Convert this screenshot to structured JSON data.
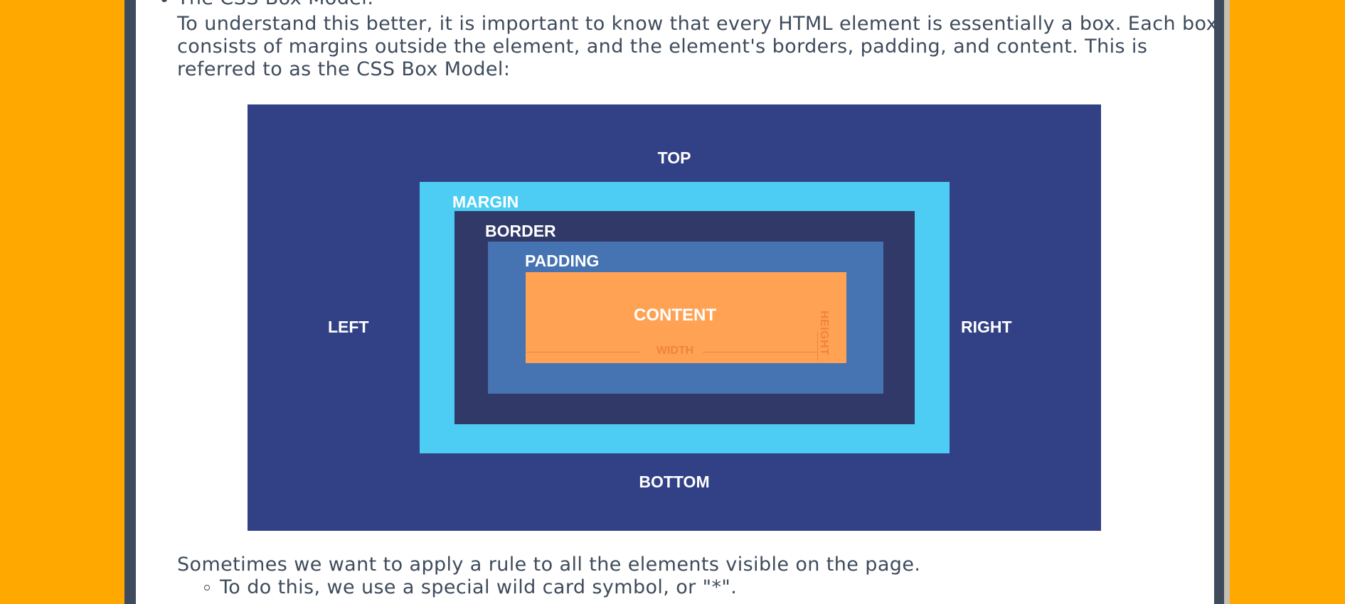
{
  "list": {
    "bullet_item": "The CSS Box Model:",
    "paragraph_lines": [
      "To understand this better, it is important to know that every HTML element is essentially a box. Each box",
      "consists of margins outside the element, and the element's borders, padding, and content. This is",
      "referred to as the CSS Box Model:"
    ],
    "paragraph_after": "Sometimes we want to apply a rule to all the elements visible on the page.",
    "sub_item": "To do this, we use a special wild card symbol, or \"*\"."
  },
  "diagram": {
    "labels": {
      "top": "TOP",
      "bottom": "BOTTOM",
      "left": "LEFT",
      "right": "RIGHT",
      "margin": "MARGIN",
      "border": "BORDER",
      "padding": "PADDING",
      "content": "CONTENT",
      "width": "WIDTH",
      "height": "HEIGHT"
    },
    "colors": {
      "outer": "#324185",
      "margin": "#4ecdf4",
      "border": "#313968",
      "padding": "#4673b1",
      "content": "#ffa254",
      "dimension": "#f08438"
    }
  },
  "theme": {
    "page_background": "#ffa800",
    "frame": "#3e4b5c",
    "text": "#3e4b5c"
  }
}
